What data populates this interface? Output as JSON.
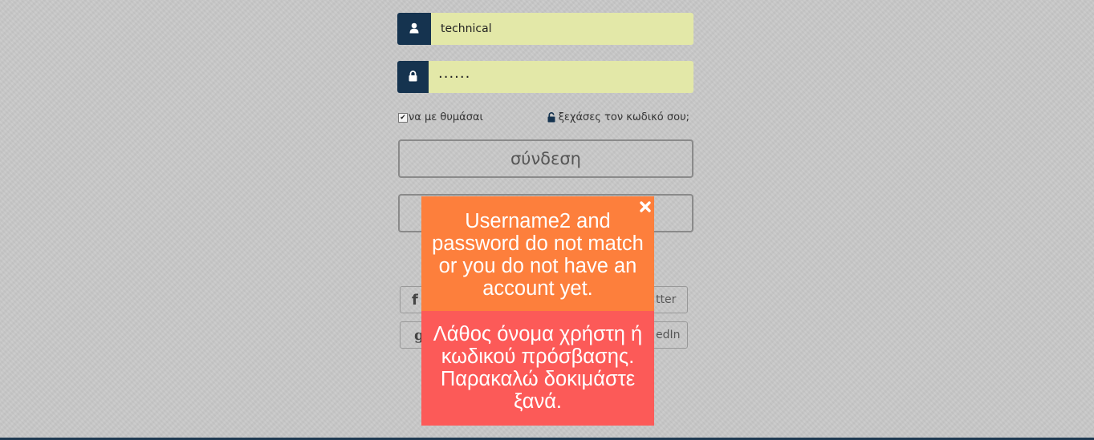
{
  "login": {
    "username_value": "technical",
    "password_value": "······",
    "remember_label": "να με θυμάσαι",
    "remember_checked": "✔",
    "forgot_label": "ξεχάσες τον κωδικό σου;",
    "login_button": "σύνδεση"
  },
  "social": {
    "facebook_icon": "f",
    "twitter_label": "tter",
    "google_icon": "g",
    "linkedin_label": "edIn"
  },
  "modal": {
    "message_en": "Username2 and password do not match or you do not have an account yet.",
    "message_gr": "Λάθος όνομα χρήστη ή κωδικού πρόσβασης. Παρακαλώ δοκιμάστε ξανά."
  },
  "icons": {
    "user": "user-icon",
    "lock": "lock-icon",
    "unlock": "unlock-icon",
    "close": "close-icon"
  },
  "colors": {
    "addon": "#15334f",
    "input_bg": "#e3e8a8",
    "modal_en_bg": "#fd7f3c",
    "modal_gr_bg": "#fc5a58",
    "background": "#c8c8c8"
  }
}
